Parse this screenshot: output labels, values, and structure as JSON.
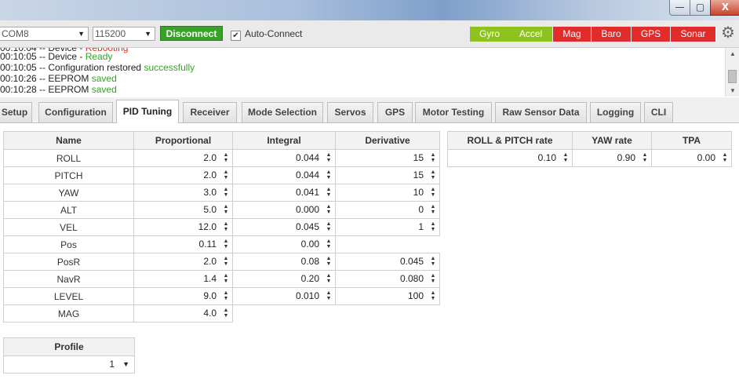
{
  "window": {
    "minimize_glyph": "—",
    "maximize_glyph": "▢",
    "close_glyph": "X"
  },
  "toolbar": {
    "port": "COM8",
    "baud": "115200",
    "disconnect_label": "Disconnect",
    "autoconnect_label": "Auto-Connect",
    "autoconnect_checked": true,
    "sensors": [
      {
        "label": "Gyro",
        "color": "#8ec21d"
      },
      {
        "label": "Accel",
        "color": "#8ec21d"
      },
      {
        "label": "Mag",
        "color": "#e22c2c"
      },
      {
        "label": "Baro",
        "color": "#e22c2c"
      },
      {
        "label": "GPS",
        "color": "#e22c2c"
      },
      {
        "label": "Sonar",
        "color": "#e22c2c"
      }
    ]
  },
  "log": [
    {
      "prefix": "00:10:05 -- Device - ",
      "suffix": "Ready",
      "suffix_class": "ok"
    },
    {
      "prefix": "00:10:05 -- Configuration restored ",
      "suffix": "successfully",
      "suffix_class": "ok"
    },
    {
      "prefix": "00:10:26 -- EEPROM ",
      "suffix": "saved",
      "suffix_class": "ok"
    },
    {
      "prefix": "00:10:28 -- EEPROM ",
      "suffix": "saved",
      "suffix_class": "ok"
    }
  ],
  "tabs": [
    {
      "label": "Setup",
      "active": false
    },
    {
      "label": "Configuration",
      "active": false
    },
    {
      "label": "PID Tuning",
      "active": true
    },
    {
      "label": "Receiver",
      "active": false
    },
    {
      "label": "Mode Selection",
      "active": false
    },
    {
      "label": "Servos",
      "active": false
    },
    {
      "label": "GPS",
      "active": false
    },
    {
      "label": "Motor Testing",
      "active": false
    },
    {
      "label": "Raw Sensor Data",
      "active": false
    },
    {
      "label": "Logging",
      "active": false
    },
    {
      "label": "CLI",
      "active": false
    }
  ],
  "pid": {
    "headers": [
      "Name",
      "Proportional",
      "Integral",
      "Derivative"
    ],
    "rows": [
      {
        "name": "ROLL",
        "p": "2.0",
        "i": "0.044",
        "d": "15"
      },
      {
        "name": "PITCH",
        "p": "2.0",
        "i": "0.044",
        "d": "15"
      },
      {
        "name": "YAW",
        "p": "3.0",
        "i": "0.041",
        "d": "10"
      },
      {
        "name": "ALT",
        "p": "5.0",
        "i": "0.000",
        "d": "0"
      },
      {
        "name": "VEL",
        "p": "12.0",
        "i": "0.045",
        "d": "1"
      },
      {
        "name": "Pos",
        "p": "0.11",
        "i": "0.00",
        "d": null
      },
      {
        "name": "PosR",
        "p": "2.0",
        "i": "0.08",
        "d": "0.045"
      },
      {
        "name": "NavR",
        "p": "1.4",
        "i": "0.20",
        "d": "0.080"
      },
      {
        "name": "LEVEL",
        "p": "9.0",
        "i": "0.010",
        "d": "100"
      },
      {
        "name": "MAG",
        "p": "4.0",
        "i": null,
        "d": null
      }
    ]
  },
  "rates": {
    "headers": [
      "ROLL & PITCH rate",
      "YAW rate",
      "TPA"
    ],
    "values": [
      "0.10",
      "0.90",
      "0.00"
    ]
  },
  "profile": {
    "header": "Profile",
    "value": "1"
  }
}
